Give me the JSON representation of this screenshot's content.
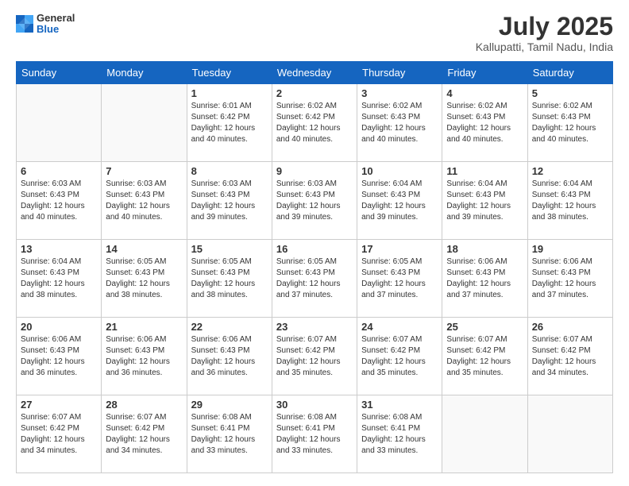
{
  "header": {
    "logo_general": "General",
    "logo_blue": "Blue",
    "title": "July 2025",
    "location": "Kallupatti, Tamil Nadu, India"
  },
  "days_of_week": [
    "Sunday",
    "Monday",
    "Tuesday",
    "Wednesday",
    "Thursday",
    "Friday",
    "Saturday"
  ],
  "weeks": [
    [
      {
        "day": "",
        "info": ""
      },
      {
        "day": "",
        "info": ""
      },
      {
        "day": "1",
        "info": "Sunrise: 6:01 AM\nSunset: 6:42 PM\nDaylight: 12 hours and 40 minutes."
      },
      {
        "day": "2",
        "info": "Sunrise: 6:02 AM\nSunset: 6:42 PM\nDaylight: 12 hours and 40 minutes."
      },
      {
        "day": "3",
        "info": "Sunrise: 6:02 AM\nSunset: 6:43 PM\nDaylight: 12 hours and 40 minutes."
      },
      {
        "day": "4",
        "info": "Sunrise: 6:02 AM\nSunset: 6:43 PM\nDaylight: 12 hours and 40 minutes."
      },
      {
        "day": "5",
        "info": "Sunrise: 6:02 AM\nSunset: 6:43 PM\nDaylight: 12 hours and 40 minutes."
      }
    ],
    [
      {
        "day": "6",
        "info": "Sunrise: 6:03 AM\nSunset: 6:43 PM\nDaylight: 12 hours and 40 minutes."
      },
      {
        "day": "7",
        "info": "Sunrise: 6:03 AM\nSunset: 6:43 PM\nDaylight: 12 hours and 40 minutes."
      },
      {
        "day": "8",
        "info": "Sunrise: 6:03 AM\nSunset: 6:43 PM\nDaylight: 12 hours and 39 minutes."
      },
      {
        "day": "9",
        "info": "Sunrise: 6:03 AM\nSunset: 6:43 PM\nDaylight: 12 hours and 39 minutes."
      },
      {
        "day": "10",
        "info": "Sunrise: 6:04 AM\nSunset: 6:43 PM\nDaylight: 12 hours and 39 minutes."
      },
      {
        "day": "11",
        "info": "Sunrise: 6:04 AM\nSunset: 6:43 PM\nDaylight: 12 hours and 39 minutes."
      },
      {
        "day": "12",
        "info": "Sunrise: 6:04 AM\nSunset: 6:43 PM\nDaylight: 12 hours and 38 minutes."
      }
    ],
    [
      {
        "day": "13",
        "info": "Sunrise: 6:04 AM\nSunset: 6:43 PM\nDaylight: 12 hours and 38 minutes."
      },
      {
        "day": "14",
        "info": "Sunrise: 6:05 AM\nSunset: 6:43 PM\nDaylight: 12 hours and 38 minutes."
      },
      {
        "day": "15",
        "info": "Sunrise: 6:05 AM\nSunset: 6:43 PM\nDaylight: 12 hours and 38 minutes."
      },
      {
        "day": "16",
        "info": "Sunrise: 6:05 AM\nSunset: 6:43 PM\nDaylight: 12 hours and 37 minutes."
      },
      {
        "day": "17",
        "info": "Sunrise: 6:05 AM\nSunset: 6:43 PM\nDaylight: 12 hours and 37 minutes."
      },
      {
        "day": "18",
        "info": "Sunrise: 6:06 AM\nSunset: 6:43 PM\nDaylight: 12 hours and 37 minutes."
      },
      {
        "day": "19",
        "info": "Sunrise: 6:06 AM\nSunset: 6:43 PM\nDaylight: 12 hours and 37 minutes."
      }
    ],
    [
      {
        "day": "20",
        "info": "Sunrise: 6:06 AM\nSunset: 6:43 PM\nDaylight: 12 hours and 36 minutes."
      },
      {
        "day": "21",
        "info": "Sunrise: 6:06 AM\nSunset: 6:43 PM\nDaylight: 12 hours and 36 minutes."
      },
      {
        "day": "22",
        "info": "Sunrise: 6:06 AM\nSunset: 6:43 PM\nDaylight: 12 hours and 36 minutes."
      },
      {
        "day": "23",
        "info": "Sunrise: 6:07 AM\nSunset: 6:42 PM\nDaylight: 12 hours and 35 minutes."
      },
      {
        "day": "24",
        "info": "Sunrise: 6:07 AM\nSunset: 6:42 PM\nDaylight: 12 hours and 35 minutes."
      },
      {
        "day": "25",
        "info": "Sunrise: 6:07 AM\nSunset: 6:42 PM\nDaylight: 12 hours and 35 minutes."
      },
      {
        "day": "26",
        "info": "Sunrise: 6:07 AM\nSunset: 6:42 PM\nDaylight: 12 hours and 34 minutes."
      }
    ],
    [
      {
        "day": "27",
        "info": "Sunrise: 6:07 AM\nSunset: 6:42 PM\nDaylight: 12 hours and 34 minutes."
      },
      {
        "day": "28",
        "info": "Sunrise: 6:07 AM\nSunset: 6:42 PM\nDaylight: 12 hours and 34 minutes."
      },
      {
        "day": "29",
        "info": "Sunrise: 6:08 AM\nSunset: 6:41 PM\nDaylight: 12 hours and 33 minutes."
      },
      {
        "day": "30",
        "info": "Sunrise: 6:08 AM\nSunset: 6:41 PM\nDaylight: 12 hours and 33 minutes."
      },
      {
        "day": "31",
        "info": "Sunrise: 6:08 AM\nSunset: 6:41 PM\nDaylight: 12 hours and 33 minutes."
      },
      {
        "day": "",
        "info": ""
      },
      {
        "day": "",
        "info": ""
      }
    ]
  ]
}
